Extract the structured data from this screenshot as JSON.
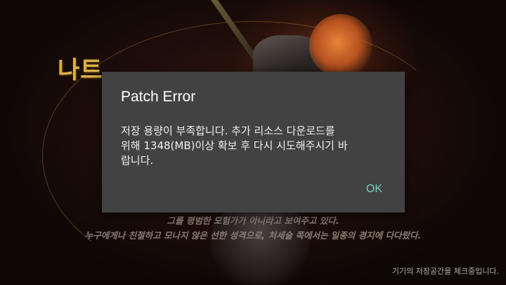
{
  "background": {
    "logo_text": "나트",
    "story_lines": [
      "그를 평범한 모험가가 아니라고 보여주고 있다.",
      "누구에게나 친절하고 모나지 않은 선한 성격으로, 처세술 쪽에서는 일종의 경지에 다다랐다."
    ],
    "status_text": "기기의 저장공간을 체크중입니다."
  },
  "dialog": {
    "title": "Patch Error",
    "message": "저장 용량이 부족합니다. 추가 리소스 다운로드를\n위해 1348(MB)이상 확보 후 다시 시도해주시기 바\n랍니다.",
    "ok_label": "OK",
    "accent_color": "#7ec8c2",
    "background_color": "#424242"
  }
}
